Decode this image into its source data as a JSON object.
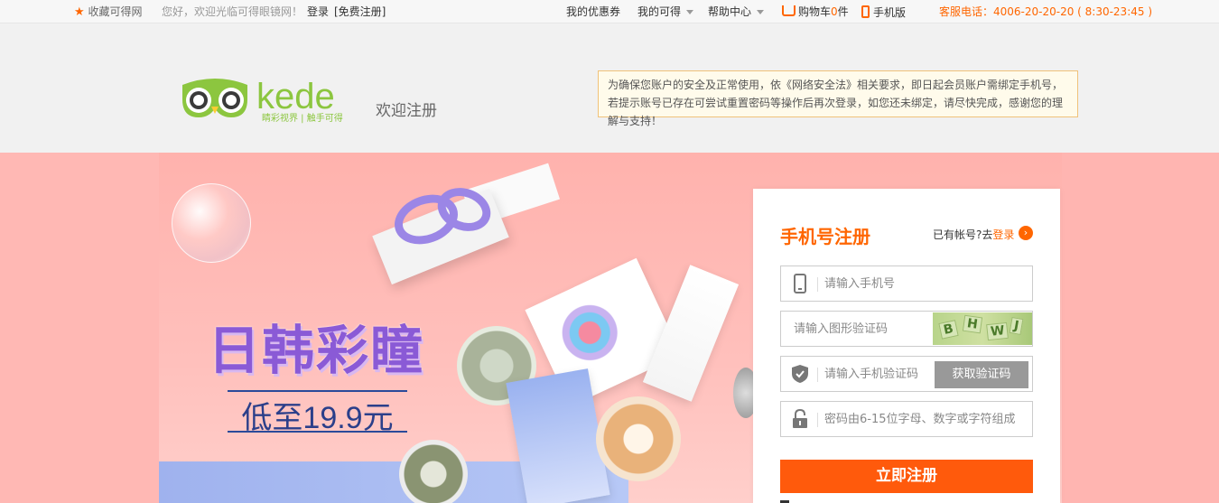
{
  "topbar": {
    "favorite": "收藏可得网",
    "greeting": "您好，欢迎光临可得眼镜网！",
    "login": "登录",
    "register": "[免费注册]",
    "coupons": "我的优惠券",
    "my_kede": "我的可得",
    "help": "帮助中心",
    "cart_label": "购物车",
    "cart_count": "0",
    "cart_unit": "件",
    "mobile": "手机版",
    "hotline": "客服电话：4006-20-20-20 ( 8:30-23:45 )"
  },
  "header": {
    "logo_text": "kede",
    "logo_slogan": "睛彩视界 | 触手可得",
    "welcome": "欢迎注册",
    "notice": "为确保您账户的安全及正常使用，依《网络安全法》相关要求，即日起会员账户需绑定手机号，若提示账号已存在可尝试重置密码等操作后再次登录，如您还未绑定，请尽快完成，感谢您的理解与支持！"
  },
  "banner": {
    "title": "日韩彩瞳",
    "price": "低至19.9元"
  },
  "form": {
    "title": "手机号注册",
    "has_account": "已有帐号?去",
    "login_link": "登录",
    "phone_placeholder": "请输入手机号",
    "captcha_placeholder": "请输入图形验证码",
    "captcha_chars": [
      "B",
      "H",
      "W",
      "J"
    ],
    "sms_placeholder": "请输入手机验证码",
    "sms_button": "获取验证码",
    "password_placeholder": "密码由6-15位字母、数字或字符组成",
    "submit": "立即注册"
  },
  "colors": {
    "accent": "#ff6600",
    "submit": "#ff5a0c",
    "banner_bg": "#ffb5b1",
    "promo_purple": "#8a5ad6"
  }
}
